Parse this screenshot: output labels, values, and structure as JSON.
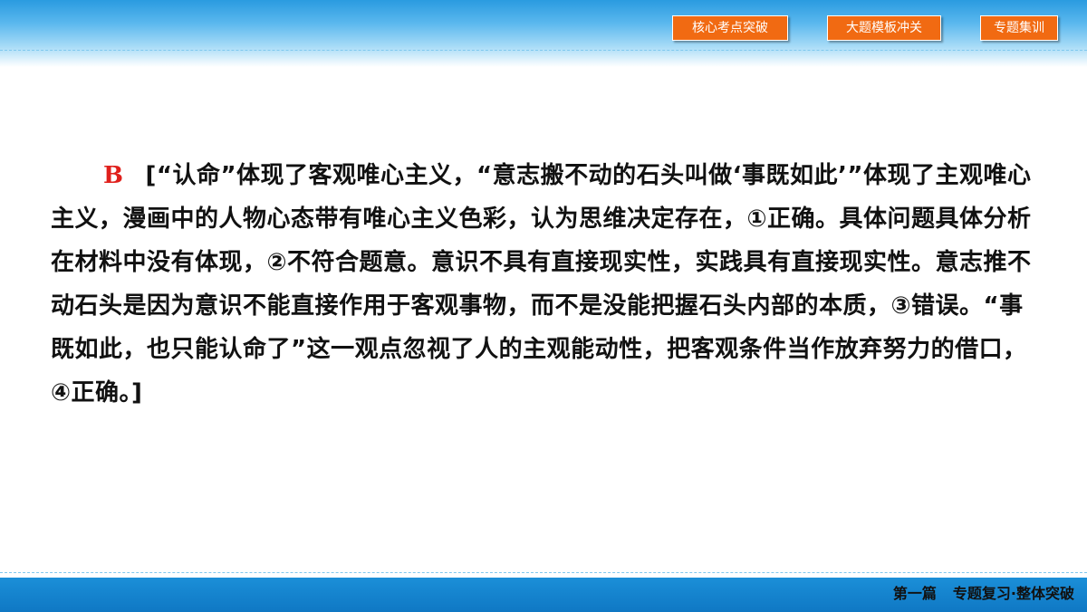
{
  "nav": {
    "btn1": "核心考点突破",
    "btn2": "大题模板冲关",
    "btn3": "专题集训"
  },
  "content": {
    "answer": "B",
    "explanation": "[“认命”体现了客观唯心主义，“意志搬不动的石头叫做‘事既如此’”体现了主观唯心主义，漫画中的人物心态带有唯心主义色彩，认为思维决定存在，①正确。具体问题具体分析在材料中没有体现，②不符合题意。意识不具有直接现实性，实践具有直接现实性。意志推不动石头是因为意识不能直接作用于客观事物，而不是没能把握石头内部的本质，③错误。“事既如此，也只能认命了”这一观点忽视了人的主观能动性，把客观条件当作放弃努力的借口，④正确。]"
  },
  "footer": {
    "part": "第一篇",
    "section": "专题复习·整体突破"
  }
}
